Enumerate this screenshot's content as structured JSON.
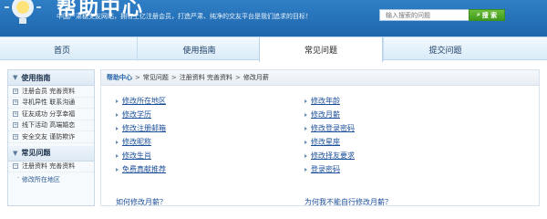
{
  "header": {
    "logo_text": "帮助中心",
    "slogan": "中国严肃稳交友网站，拥有上亿注册会员，打造严肃、纯净的交友平台是我们追求的目标！",
    "search": {
      "placeholder": "输入搜索的问题",
      "button_label": "搜 索"
    }
  },
  "nav": {
    "tabs": [
      {
        "label": "首页"
      },
      {
        "label": "使用指南"
      },
      {
        "label": "常见问题"
      },
      {
        "label": "提交问题"
      }
    ],
    "active": "常见问题"
  },
  "sidebar": {
    "section1": {
      "title": "使用指南"
    },
    "items": [
      {
        "label": "注册会员 完善资料"
      },
      {
        "label": "寻机异性 联系沟通"
      },
      {
        "label": "征友成功 分享幸福"
      },
      {
        "label": "线下活动 高端婚恋"
      },
      {
        "label": "安全交友 谨防欺诈"
      }
    ],
    "section2": {
      "title": "常见问题"
    },
    "sub_group": {
      "label": "注册资料 完善资料"
    },
    "sub_item": {
      "label": "修改所在地区"
    }
  },
  "breadcrumb": {
    "home": "帮助中心",
    "items": [
      "常见问题",
      "注册资料 完善资料",
      "修改月薪"
    ]
  },
  "faq": {
    "col1": [
      "修改所在地区",
      "修改学历",
      "修改注册邮箱",
      "修改昵称",
      "修改生肖",
      "免费真献推荐"
    ],
    "col2": [
      "修改年龄",
      "修改月薪",
      "修改登录密码",
      "修改星座",
      "修改择友要求",
      "登录密码"
    ],
    "cut1": "如何修改月薪？",
    "cut2": "为何我不能自行修改月薪？"
  },
  "colors": {
    "brand": "#2f7fc6",
    "link": "#1c4f99",
    "search_button": "#4fa82a"
  }
}
